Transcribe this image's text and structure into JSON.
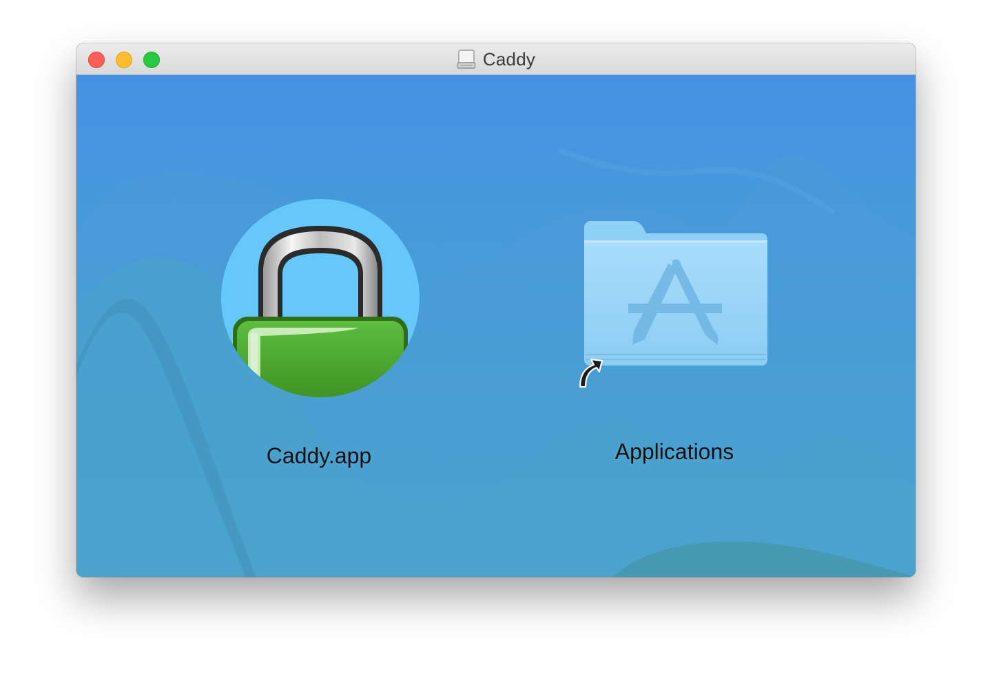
{
  "window": {
    "title": "Caddy",
    "title_icon": "disk-image-icon",
    "controls": [
      "close",
      "minimize",
      "zoom"
    ]
  },
  "items": [
    {
      "label": "Caddy.app",
      "icon": "padlock-icon"
    },
    {
      "label": "Applications",
      "icon": "applications-folder-icon",
      "alias": true
    }
  ],
  "colors": {
    "background_top": "#4592e4",
    "background_bottom": "#4eafc3",
    "close": "#fc5f57",
    "minimize": "#fdbd2e",
    "zoom": "#28c840"
  }
}
